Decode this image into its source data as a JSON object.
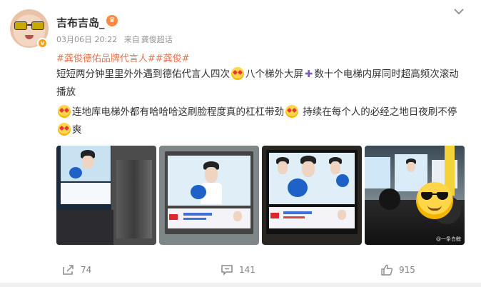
{
  "post": {
    "username": "吉布吉岛_",
    "date": "03月06日 20:22",
    "source_prefix": "来自",
    "source": "龚俊超话",
    "tags": "#龚俊德佑品牌代言人##龚俊#",
    "p1_a": "短短两分钟里里外外遇到德佑代言人四次",
    "p1_b": "八个梯外大屏",
    "p1_c": "数十个电梯内屏同时超高频次滚动播放",
    "p2_a": "连地库电梯外都有哈哈哈这刷脸程度真的杠杠带劲",
    "p2_b": "持续在每个人的必经之地日夜刷不停",
    "p2_c": "爽",
    "image_watermark": "@一条白鲸"
  },
  "icons": {
    "avatar_badge": "v-badge-icon",
    "crown": "crown-icon",
    "menu": "chevron-down-icon",
    "emoji": "heart-eyes-emoji-icon",
    "plus": "plus-icon",
    "share": "share-icon",
    "comment": "comment-icon",
    "like": "thumbs-up-icon"
  },
  "actions": {
    "share_count": "74",
    "comment_count": "141",
    "like_count": "915"
  },
  "colors": {
    "tag": "#eb7350",
    "meta": "#939393",
    "text": "#333333",
    "badge": "#f7a21d"
  }
}
